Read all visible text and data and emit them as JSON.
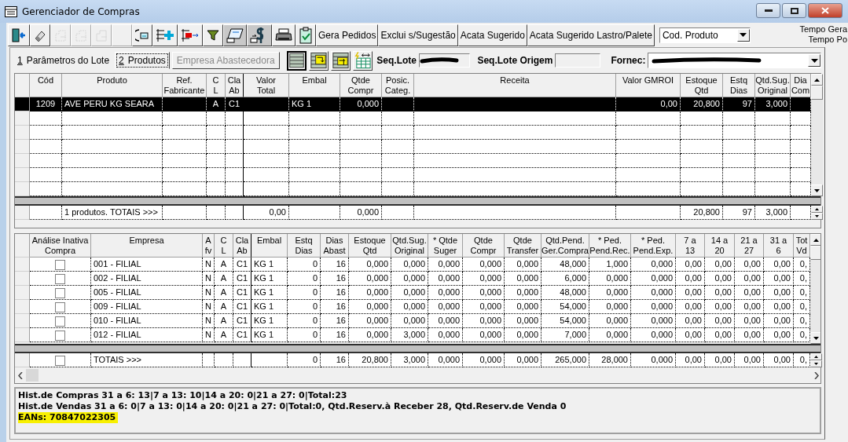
{
  "window": {
    "title": "Gerenciador de Compras"
  },
  "toolbar": {
    "icon_buttons": [
      {
        "kind": "exit",
        "disabled": false,
        "pressed": false
      },
      {
        "kind": "eraser",
        "disabled": false,
        "pressed": false
      },
      {
        "kind": "doc-up",
        "disabled": true,
        "pressed": false
      },
      {
        "kind": "doc-down",
        "disabled": true,
        "pressed": false
      },
      {
        "kind": "doc-list",
        "disabled": true,
        "pressed": false
      },
      {
        "kind": "blank",
        "disabled": true,
        "pressed": false
      },
      {
        "kind": "cycle",
        "disabled": false,
        "pressed": false
      },
      {
        "kind": "add",
        "disabled": false,
        "pressed": false
      },
      {
        "kind": "remove",
        "disabled": false,
        "pressed": false
      },
      {
        "kind": "filter",
        "disabled": false,
        "pressed": false
      },
      {
        "kind": "card",
        "disabled": false,
        "pressed": true
      },
      {
        "kind": "dollar",
        "disabled": false,
        "pressed": true
      },
      {
        "kind": "printer",
        "disabled": false,
        "pressed": false
      },
      {
        "kind": "clipboard",
        "disabled": false,
        "pressed": false
      }
    ],
    "text_buttons": [
      "Gera Pedidos",
      "Exclui s/Sugestão",
      "Acata Sugerido",
      "Acata Sugerido Lastro/Palete"
    ],
    "sort_dropdown": {
      "value": "Cod. Produto"
    },
    "timing_labels": [
      "Tempo Gera",
      "Tempo Po"
    ]
  },
  "tabs": [
    {
      "hotkey": "1",
      "label": "Parâmetros do Lote",
      "selected": false
    },
    {
      "hotkey": "2",
      "label": "Produtos",
      "selected": true
    }
  ],
  "supplier_button": {
    "label": "Empresa Abastecedora",
    "disabled": true
  },
  "view_buttons": [
    {
      "kind": "grid",
      "pressed": true
    },
    {
      "kind": "grid-arrow",
      "pressed": false
    },
    {
      "kind": "grid-arrows",
      "pressed": false
    },
    {
      "kind": "table-bolt",
      "pressed": false
    }
  ],
  "seq_lote": {
    "label": "Seq.Lote"
  },
  "seq_lote_origem": {
    "label": "Seq.Lote Origem"
  },
  "fornec": {
    "label": "Fornec:"
  },
  "top_grid": {
    "columns": [
      {
        "header": [
          "Cód"
        ]
      },
      {
        "header": [
          "Produto"
        ]
      },
      {
        "header": [
          "Ref.",
          "Fabricante"
        ]
      },
      {
        "header": [
          "C",
          "L"
        ]
      },
      {
        "header": [
          "Cla",
          "Ab"
        ]
      },
      {
        "header": [
          "Valor",
          "Total"
        ]
      },
      {
        "header": [
          "Embal"
        ]
      },
      {
        "header": [
          "Qtde",
          "Compr"
        ]
      },
      {
        "header": [
          "Posic.",
          "Categ."
        ]
      },
      {
        "header": [
          "Receita"
        ]
      },
      {
        "header": [
          "Valor GMROI"
        ]
      },
      {
        "header": [
          "Estoque",
          "Qtd"
        ]
      },
      {
        "header": [
          "Estq",
          "Dias"
        ]
      },
      {
        "header": [
          "Qtd.Sug.",
          "Original"
        ]
      },
      {
        "header": [
          "Dia",
          "Com"
        ]
      }
    ],
    "rows": [
      {
        "selected": true,
        "cod": "1209",
        "produto": "AVE PERU KG SEARA",
        "cl": "A",
        "claab": "C1",
        "embal": "KG 1",
        "qtde_compr": "0,000",
        "gmroi": "0,00",
        "estoque": "20,800",
        "estq_dias": "97",
        "qtd_sug": "3,000"
      }
    ],
    "totals": {
      "produto": "1 produtos. TOTAIS >>>",
      "valor_total": "0,00",
      "qtde_compr": "0,000",
      "estoque": "20,800",
      "estq_dias": "97",
      "qtd_sug": "3,000"
    }
  },
  "bottom_grid": {
    "columns": [
      {
        "header": [
          "Análise Inativa",
          "Compra"
        ]
      },
      {
        "header": [
          "Empresa"
        ]
      },
      {
        "header": [
          "A",
          "fv"
        ]
      },
      {
        "header": [
          "C",
          "L"
        ]
      },
      {
        "header": [
          "Cla",
          "Ab"
        ]
      },
      {
        "header": [
          "Embal"
        ]
      },
      {
        "header": [
          "Estq",
          "Dias"
        ]
      },
      {
        "header": [
          "Dias",
          "Abast"
        ]
      },
      {
        "header": [
          "Estoque",
          "Qtd"
        ]
      },
      {
        "header": [
          "Qtd.Sug.",
          "Original"
        ]
      },
      {
        "header": [
          "* Qtde",
          "Suger"
        ]
      },
      {
        "header": [
          "Qtde",
          "Compr"
        ]
      },
      {
        "header": [
          "Qtde",
          "Transfer"
        ]
      },
      {
        "header": [
          "Qtd.Pend.",
          "Ger.Compra"
        ]
      },
      {
        "header": [
          "* Ped.",
          "Pend.Rec."
        ]
      },
      {
        "header": [
          "* Ped.",
          "Pend.Exp."
        ]
      },
      {
        "header": [
          "7 a",
          "13"
        ]
      },
      {
        "header": [
          "14 a",
          "20"
        ]
      },
      {
        "header": [
          "21 a",
          "27"
        ]
      },
      {
        "header": [
          "31 a",
          "6"
        ]
      },
      {
        "header": [
          "Tot",
          "Vd"
        ]
      }
    ],
    "rows": [
      {
        "checked": false,
        "empresa": "001 - FILIAL",
        "afv": "N",
        "cl": "A",
        "claab": "C1",
        "embal": "KG 1",
        "estq_dias": "0",
        "dias_abast": "16",
        "estoque": "0,000",
        "qtd_sug": "0,000",
        "qtde_suger": "0,000",
        "qtde_compr": "0,000",
        "qtde_transfer": "0,000",
        "pend_ger": "48,000",
        "pend_rec": "1,000",
        "pend_exp": "0,000",
        "d7": "0,00",
        "d14": "0,00",
        "d21": "0,00",
        "d31": "0,00",
        "tot_vd": "0,"
      },
      {
        "checked": false,
        "empresa": "002 - FILIAL",
        "afv": "N",
        "cl": "A",
        "claab": "C1",
        "embal": "KG 1",
        "estq_dias": "0",
        "dias_abast": "16",
        "estoque": "0,000",
        "qtd_sug": "0,000",
        "qtde_suger": "0,000",
        "qtde_compr": "0,000",
        "qtde_transfer": "0,000",
        "pend_ger": "6,000",
        "pend_rec": "0,000",
        "pend_exp": "0,000",
        "d7": "0,00",
        "d14": "0,00",
        "d21": "0,00",
        "d31": "0,00",
        "tot_vd": "0,"
      },
      {
        "checked": false,
        "empresa": "005 - FILIAL",
        "afv": "N",
        "cl": "A",
        "claab": "C1",
        "embal": "KG 1",
        "estq_dias": "0",
        "dias_abast": "16",
        "estoque": "0,000",
        "qtd_sug": "0,000",
        "qtde_suger": "0,000",
        "qtde_compr": "0,000",
        "qtde_transfer": "0,000",
        "pend_ger": "48,000",
        "pend_rec": "0,000",
        "pend_exp": "0,000",
        "d7": "0,00",
        "d14": "0,00",
        "d21": "0,00",
        "d31": "0,00",
        "tot_vd": "0,"
      },
      {
        "checked": false,
        "empresa": "009 - FILIAL",
        "afv": "N",
        "cl": "A",
        "claab": "C1",
        "embal": "KG 1",
        "estq_dias": "0",
        "dias_abast": "16",
        "estoque": "0,000",
        "qtd_sug": "0,000",
        "qtde_suger": "0,000",
        "qtde_compr": "0,000",
        "qtde_transfer": "0,000",
        "pend_ger": "54,000",
        "pend_rec": "0,000",
        "pend_exp": "0,000",
        "d7": "0,00",
        "d14": "0,00",
        "d21": "0,00",
        "d31": "0,00",
        "tot_vd": "0,"
      },
      {
        "checked": false,
        "empresa": "010 - FILIAL",
        "afv": "N",
        "cl": "A",
        "claab": "C1",
        "embal": "KG 1",
        "estq_dias": "0",
        "dias_abast": "16",
        "estoque": "0,000",
        "qtd_sug": "0,000",
        "qtde_suger": "0,000",
        "qtde_compr": "0,000",
        "qtde_transfer": "0,000",
        "pend_ger": "54,000",
        "pend_rec": "0,000",
        "pend_exp": "0,000",
        "d7": "0,00",
        "d14": "0,00",
        "d21": "0,00",
        "d31": "0,00",
        "tot_vd": "0,"
      },
      {
        "checked": false,
        "empresa": "012 - FILIAL",
        "afv": "N",
        "cl": "A",
        "claab": "C1",
        "embal": "KG 1",
        "estq_dias": "0",
        "dias_abast": "16",
        "estoque": "0,000",
        "qtd_sug": "3,000",
        "qtde_suger": "0,000",
        "qtde_compr": "0,000",
        "qtde_transfer": "0,000",
        "pend_ger": "7,000",
        "pend_rec": "0,000",
        "pend_exp": "0,000",
        "d7": "0,00",
        "d14": "0,00",
        "d21": "0,00",
        "d31": "0,00",
        "tot_vd": "0,"
      }
    ],
    "totals": {
      "checked": false,
      "empresa": "TOTAIS >>>",
      "estq_dias": "0",
      "dias_abast": "16",
      "estoque": "20,800",
      "qtd_sug": "3,000",
      "qtde_suger": "0,000",
      "qtde_compr": "0,000",
      "qtde_transfer": "0,000",
      "pend_ger": "265,000",
      "pend_rec": "28,000",
      "pend_exp": "0,000",
      "d7": "0,00",
      "d14": "0,00",
      "d21": "0,00",
      "d31": "0,00",
      "tot_vd": "0,"
    }
  },
  "info_panel": {
    "lines": [
      {
        "text": "Hist.de Compras 31 a 6: 13|7 a 13: 10|14 a 20: 0|21 a 27: 0|Total:23",
        "highlighted": false
      },
      {
        "text": "Hist.de Vendas 31 a 6: 0|7 a 13: 0|14 a 20: 0|21 a 27: 0|Total:0, Qtd.Reserv.à Receber 28, Qtd.Reserv.de Venda 0",
        "highlighted": false
      },
      {
        "text": "EANs: 70847022305",
        "highlighted": true
      }
    ]
  }
}
